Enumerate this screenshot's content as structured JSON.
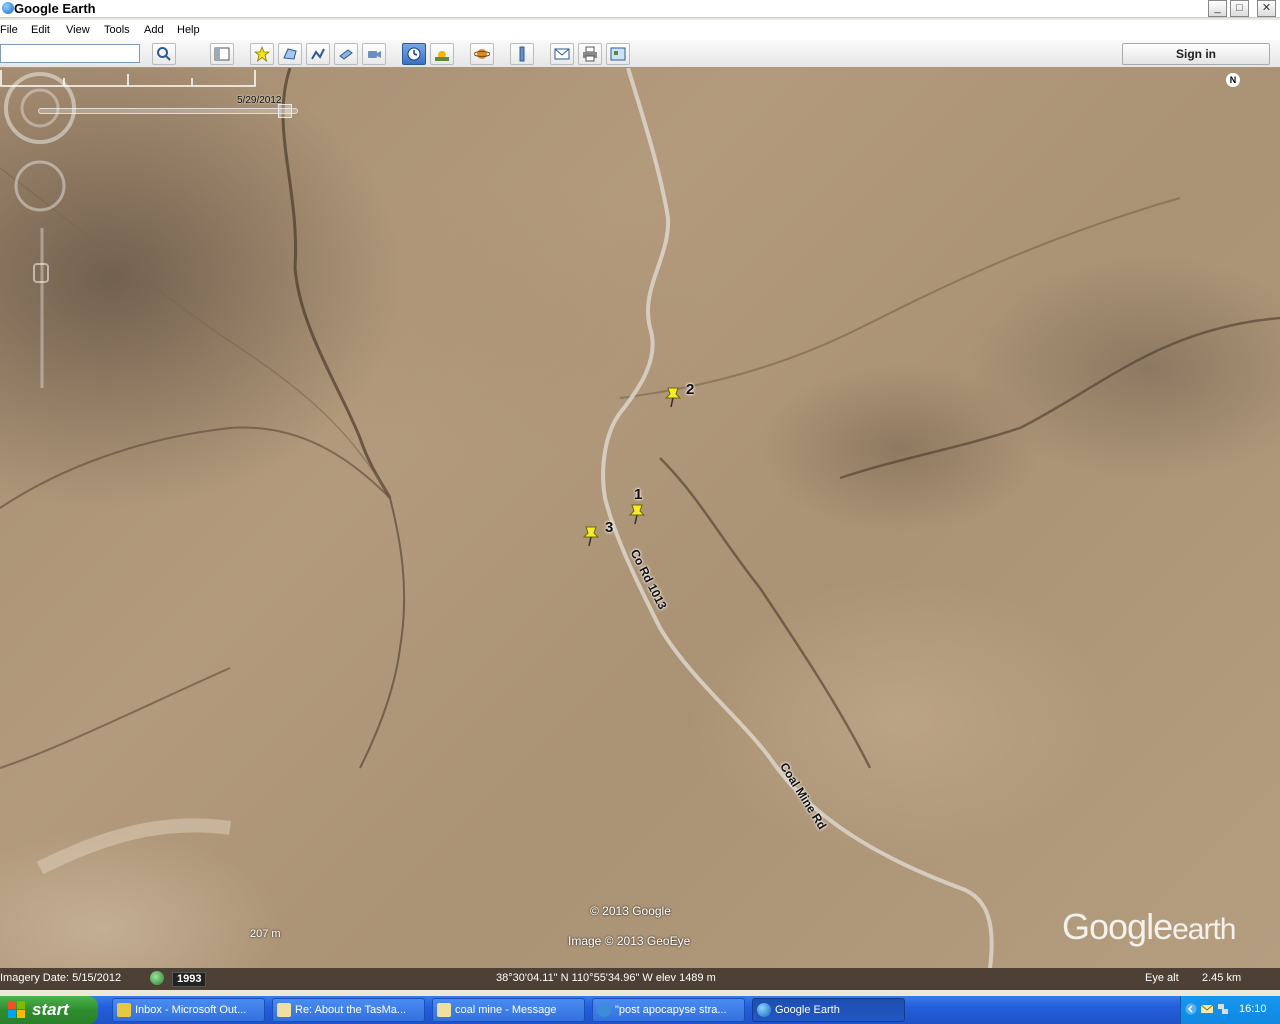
{
  "window": {
    "title": "Google Earth"
  },
  "menu": [
    "File",
    "Edit",
    "View",
    "Tools",
    "Add",
    "Help"
  ],
  "toolbar": {
    "search_placeholder": "",
    "sign_in_label": "Sign in"
  },
  "map": {
    "slider_date": "5/29/2012",
    "placemarks": [
      {
        "label": "1"
      },
      {
        "label": "2"
      },
      {
        "label": "3"
      }
    ],
    "roads": [
      "Co Rd 1013",
      "Coal Mine Rd"
    ],
    "compass_label": "N",
    "copyright_google": "© 2013 Google",
    "copyright_image": "Image © 2013 GeoEye",
    "logo_google": "Google",
    "logo_earth": "earth",
    "scale_label": "207 m"
  },
  "status": {
    "imagery_date": "Imagery Date: 5/15/2012",
    "year": "1993",
    "coordinates": "38°30'04.11\" N  110°55'34.96\" W  elev  1489 m",
    "eye_alt_label": "Eye alt",
    "eye_alt_value": "2.45 km"
  },
  "taskbar": {
    "start_label": "start",
    "tasks": [
      {
        "label": "Inbox - Microsoft Out...",
        "active": false
      },
      {
        "label": "Re: About the TasMa...",
        "active": false
      },
      {
        "label": "coal mine - Message",
        "active": false
      },
      {
        "label": "\"post apocapyse stra...",
        "active": false
      },
      {
        "label": "Google Earth",
        "active": true
      }
    ],
    "clock": "16:10"
  },
  "colors": {
    "taskbar_blue": "#245edb",
    "start_green": "#2e8e2e",
    "pin_yellow": "#f5ec2a",
    "terrain": "#b09878"
  }
}
